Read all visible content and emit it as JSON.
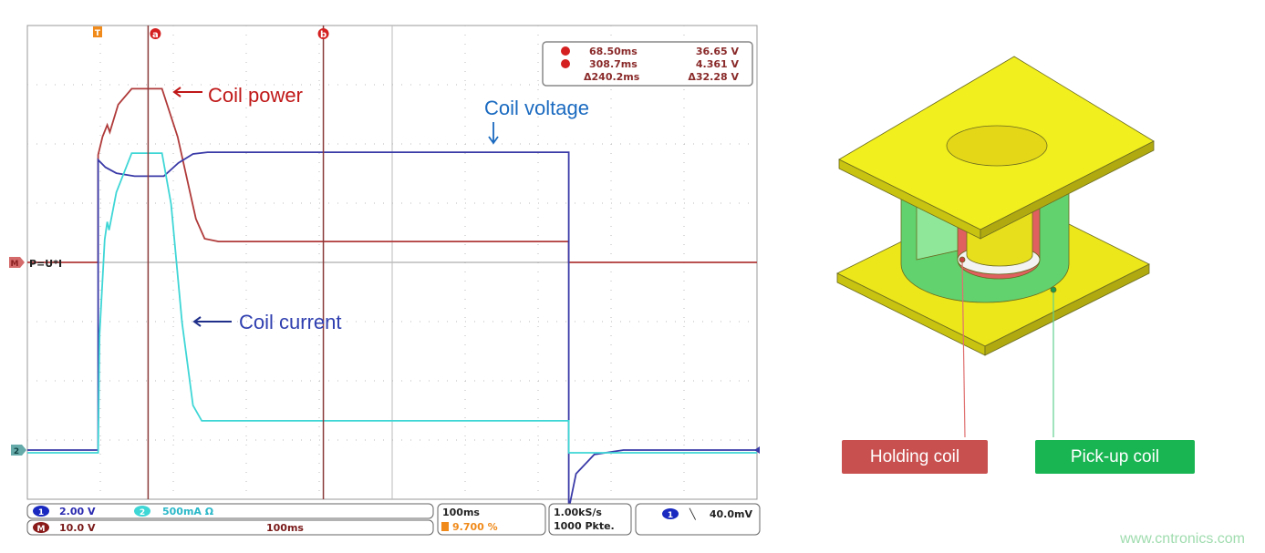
{
  "annotations": {
    "coil_power": "Coil power",
    "coil_voltage": "Coil voltage",
    "coil_current": "Coil current"
  },
  "cursor_readout": {
    "a_marker": "a",
    "a_time": "68.50ms",
    "a_value": "36.65 V",
    "b_marker": "b",
    "b_time": "308.7ms",
    "b_value": "4.361 V",
    "delta_time": "Δ240.2ms",
    "delta_value": "Δ32.28 V"
  },
  "markers": {
    "trigger": "T",
    "math_channel": "M",
    "math_label": "P=U*I",
    "ch2": "2",
    "ch1": "1"
  },
  "status_bar": {
    "ch1_num": "1",
    "ch1_scale": "2.00 V",
    "ch2_num": "2",
    "ch2_scale": "500mA Ω",
    "math_num": "M",
    "math_scale": "10.0 V",
    "math_time": "100ms",
    "timebase": "100ms",
    "trigger_pos": "9.700 %",
    "sample_rate": "1.00kS/s",
    "record_length": "1000 Pkte.",
    "trig_source": "1",
    "trig_slope": "╲",
    "trig_level": "40.0mV"
  },
  "labels": {
    "holding_coil": "Holding  coil",
    "pickup_coil": "Pick-up coil"
  },
  "watermark": "www.cntronics.com",
  "colors": {
    "power": "#b03a3a",
    "voltage": "#3a3aa8",
    "current": "#3fd6d6",
    "holding": "#c85150",
    "pickup": "#19b553",
    "yolk": "#f2ef1e"
  },
  "chart_data": {
    "type": "line",
    "xlabel": "",
    "ylabel": "",
    "x_unit": "ms",
    "xlim": [
      -97,
      903
    ],
    "grid": true,
    "cursors": [
      68.5,
      308.7
    ],
    "series": [
      {
        "name": "Coil power",
        "unit": "W",
        "color": "#b03a3a",
        "points": [
          [
            -97,
            0
          ],
          [
            0,
            0
          ],
          [
            0,
            22.7
          ],
          [
            6,
            26.5
          ],
          [
            12.5,
            29
          ],
          [
            16,
            27.5
          ],
          [
            27.5,
            33.3
          ],
          [
            46,
            36.65
          ],
          [
            87.5,
            36.65
          ],
          [
            109,
            26.5
          ],
          [
            134,
            9.2
          ],
          [
            146,
            5
          ],
          [
            165,
            4.4
          ],
          [
            645,
            4.4
          ],
          [
            645,
            0
          ],
          [
            903,
            0
          ]
        ]
      },
      {
        "name": "Coil voltage",
        "unit": "V",
        "color": "#3a3aa8",
        "points": [
          [
            -97,
            0
          ],
          [
            0,
            0
          ],
          [
            0,
            9.8
          ],
          [
            10,
            9.55
          ],
          [
            25,
            9.35
          ],
          [
            50,
            9.25
          ],
          [
            90,
            9.25
          ],
          [
            110,
            9.7
          ],
          [
            130,
            10.0
          ],
          [
            150,
            10.06
          ],
          [
            645,
            10.06
          ],
          [
            645,
            -2
          ],
          [
            655,
            -0.8
          ],
          [
            680,
            -0.15
          ],
          [
            720,
            0
          ],
          [
            903,
            0
          ]
        ]
      },
      {
        "name": "Coil current",
        "unit": "A",
        "color": "#3fd6d6",
        "points": [
          [
            -97,
            0
          ],
          [
            0,
            0
          ],
          [
            2,
            1.0
          ],
          [
            9,
            1.8
          ],
          [
            12.5,
            1.95
          ],
          [
            15,
            1.88
          ],
          [
            25,
            2.2
          ],
          [
            46,
            2.53
          ],
          [
            87.5,
            2.53
          ],
          [
            100,
            2.1
          ],
          [
            115,
            1.1
          ],
          [
            130,
            0.4
          ],
          [
            142,
            0.27
          ],
          [
            645,
            0.27
          ],
          [
            645,
            0
          ],
          [
            903,
            0
          ]
        ]
      }
    ]
  }
}
